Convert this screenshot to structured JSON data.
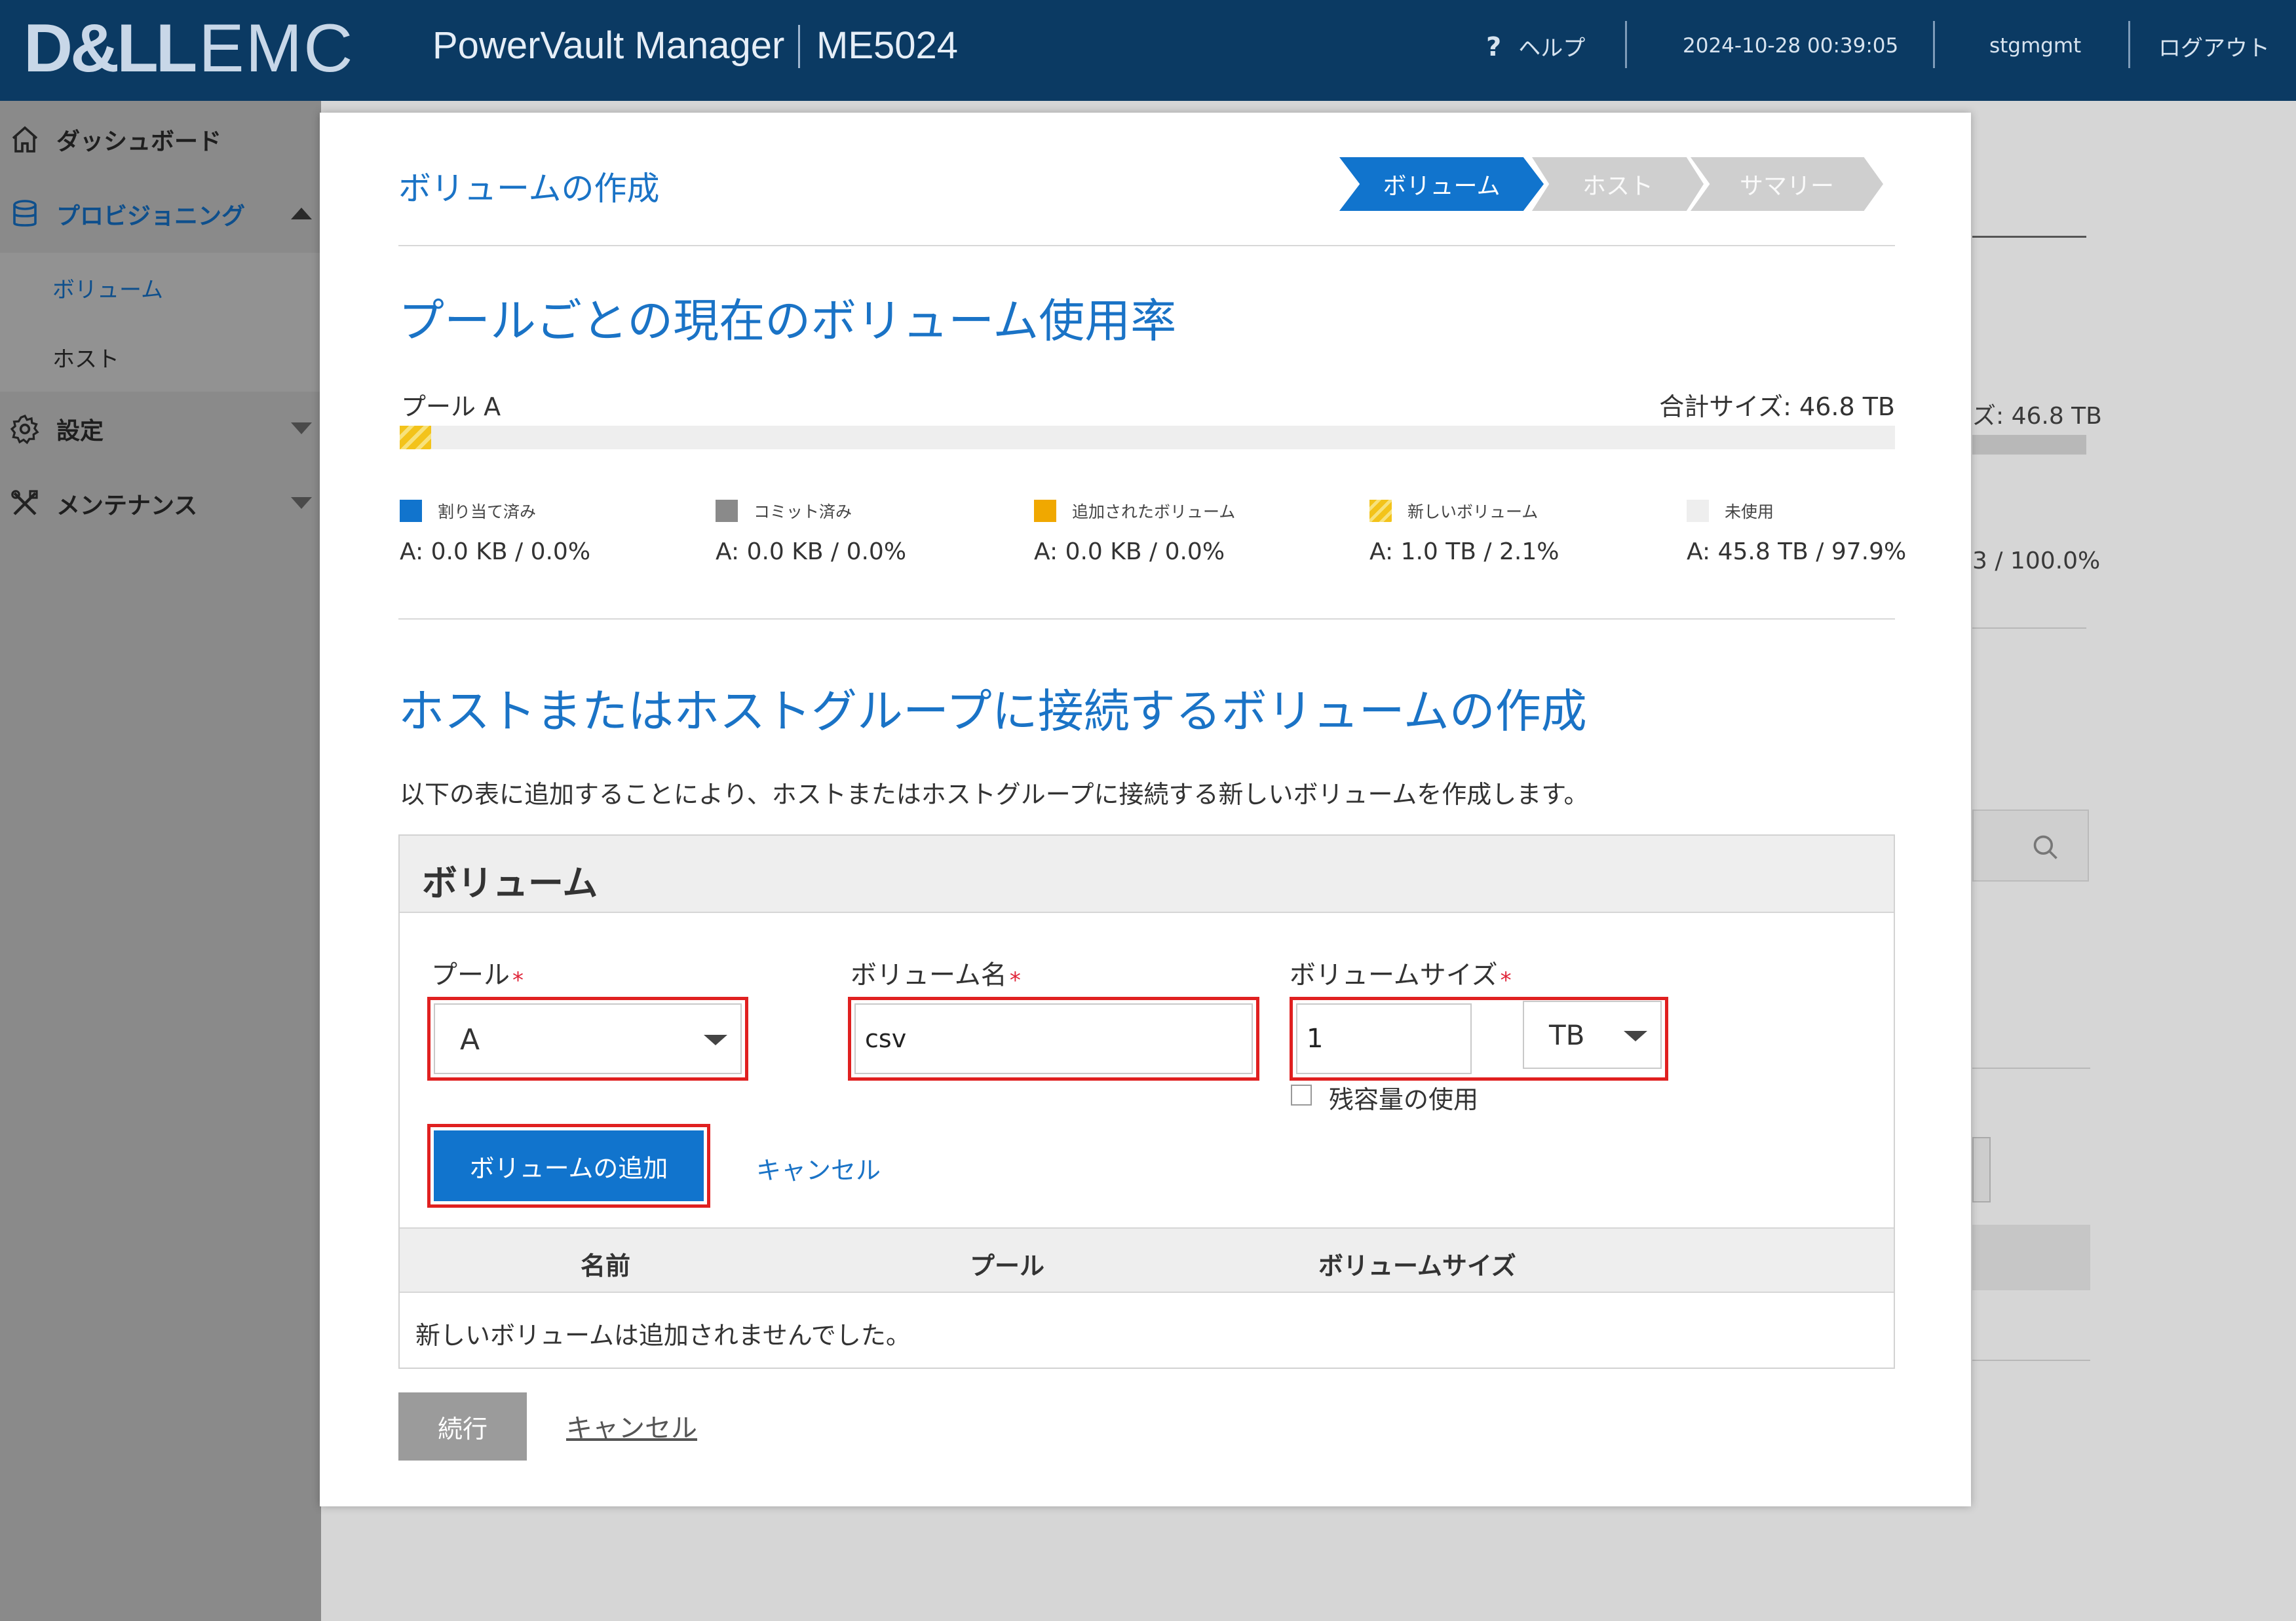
{
  "header": {
    "logo_dell": "D&LL",
    "logo_emc": "EMC",
    "app_title": "PowerVault Manager",
    "model": "ME5024",
    "help_glyph": "?",
    "help_label": "ヘルプ",
    "datetime": "2024-10-28 00:39:05",
    "user": "stgmgmt",
    "logout": "ログアウト"
  },
  "sidebar": {
    "dashboard": "ダッシュボード",
    "provisioning": "プロビジョニング",
    "volumes": "ボリューム",
    "hosts": "ホスト",
    "settings": "設定",
    "maintenance": "メンテナンス"
  },
  "background": {
    "size_fragment": "ズ: 46.8 TB",
    "pct_fragment": "3 / 100.0%"
  },
  "modal": {
    "title": "ボリュームの作成",
    "steps": [
      "ボリューム",
      "ホスト",
      "サマリー"
    ],
    "active_step": 0,
    "usage_title": "プールごとの現在のボリューム使用率",
    "pool_label": "プール A",
    "total_size": "合計サイズ: 46.8 TB",
    "usage_new_fraction": 0.021,
    "legend": [
      {
        "label": "割り当て済み",
        "value": "A: 0.0 KB / 0.0%",
        "color": "#1174cd"
      },
      {
        "label": "コミット済み",
        "value": "A: 0.0 KB / 0.0%",
        "color": "#8a8a8a"
      },
      {
        "label": "追加されたボリューム",
        "value": "A: 0.0 KB / 0.0%",
        "color": "#f0a800"
      },
      {
        "label": "新しいボリューム",
        "value": "A: 1.0 TB / 2.1%",
        "color": "#f3c31a"
      },
      {
        "label": "未使用",
        "value": "A: 45.8 TB / 97.9%",
        "color": "#eeeeee"
      }
    ],
    "create_title": "ホストまたはホストグループに接続するボリュームの作成",
    "description": "以下の表に追加することにより、ホストまたはホストグループに接続する新しいボリュームを作成します。",
    "panel": {
      "header": "ボリューム",
      "pool_label": "プール",
      "pool_value": "A",
      "name_label": "ボリューム名",
      "name_value": "csv",
      "size_label": "ボリュームサイズ",
      "size_value": "1",
      "unit_value": "TB",
      "required_mark": "*",
      "use_remaining": "残容量の使用",
      "add_button": "ボリュームの追加",
      "cancel": "キャンセル",
      "columns": [
        "名前",
        "プール",
        "ボリュームサイズ"
      ],
      "empty_message": "新しいボリュームは追加されませんでした。"
    },
    "continue": "続行",
    "cancel": "キャンセル"
  }
}
